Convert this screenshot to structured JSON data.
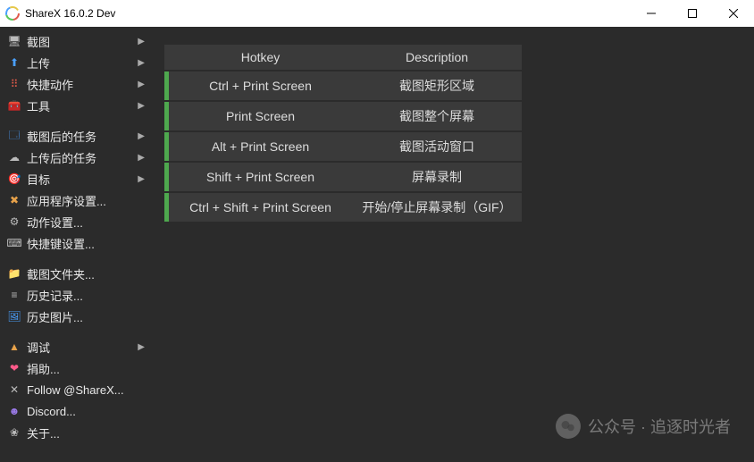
{
  "window": {
    "title": "ShareX 16.0.2 Dev"
  },
  "sidebar": {
    "groups": [
      [
        {
          "icon": "🖥",
          "iconClass": "c-gray",
          "label": "截图",
          "submenu": true
        },
        {
          "icon": "⬆",
          "iconClass": "c-blue",
          "label": "上传",
          "submenu": true
        },
        {
          "icon": "⠿",
          "iconClass": "c-red",
          "label": "快捷动作",
          "submenu": true
        },
        {
          "icon": "🧰",
          "iconClass": "c-red",
          "label": "工具",
          "submenu": true
        }
      ],
      [
        {
          "icon": "🗔",
          "iconClass": "c-blue",
          "label": "截图后的任务",
          "submenu": true
        },
        {
          "icon": "☁",
          "iconClass": "c-gray",
          "label": "上传后的任务",
          "submenu": true
        },
        {
          "icon": "🎯",
          "iconClass": "c-blue",
          "label": "目标",
          "submenu": true
        },
        {
          "icon": "✖",
          "iconClass": "c-orange",
          "label": "应用程序设置...",
          "submenu": false
        },
        {
          "icon": "⚙",
          "iconClass": "c-gray",
          "label": "动作设置...",
          "submenu": false
        },
        {
          "icon": "⌨",
          "iconClass": "c-gray",
          "label": "快捷键设置...",
          "submenu": false
        }
      ],
      [
        {
          "icon": "📁",
          "iconClass": "c-yellow",
          "label": "截图文件夹...",
          "submenu": false
        },
        {
          "icon": "≡",
          "iconClass": "c-gray",
          "label": "历史记录...",
          "submenu": false
        },
        {
          "icon": "🖼",
          "iconClass": "c-blue",
          "label": "历史图片...",
          "submenu": false
        }
      ],
      [
        {
          "icon": "▲",
          "iconClass": "c-orange",
          "label": "调试",
          "submenu": true
        },
        {
          "icon": "❤",
          "iconClass": "c-pink",
          "label": "捐助...",
          "submenu": false
        },
        {
          "icon": "✕",
          "iconClass": "c-gray",
          "label": "Follow @ShareX...",
          "submenu": false
        },
        {
          "icon": "☻",
          "iconClass": "c-purple",
          "label": "Discord...",
          "submenu": false
        },
        {
          "icon": "❀",
          "iconClass": "c-gray",
          "label": "关于...",
          "submenu": false
        }
      ]
    ]
  },
  "table": {
    "headers": {
      "hotkey": "Hotkey",
      "description": "Description"
    },
    "rows": [
      {
        "hotkey": "Ctrl + Print Screen",
        "description": "截图矩形区域"
      },
      {
        "hotkey": "Print Screen",
        "description": "截图整个屏幕"
      },
      {
        "hotkey": "Alt + Print Screen",
        "description": "截图活动窗口"
      },
      {
        "hotkey": "Shift + Print Screen",
        "description": "屏幕录制"
      },
      {
        "hotkey": "Ctrl + Shift + Print Screen",
        "description": "开始/停止屏幕录制（GIF）"
      }
    ]
  },
  "watermark": {
    "text": "公众号 · 追逐时光者"
  }
}
